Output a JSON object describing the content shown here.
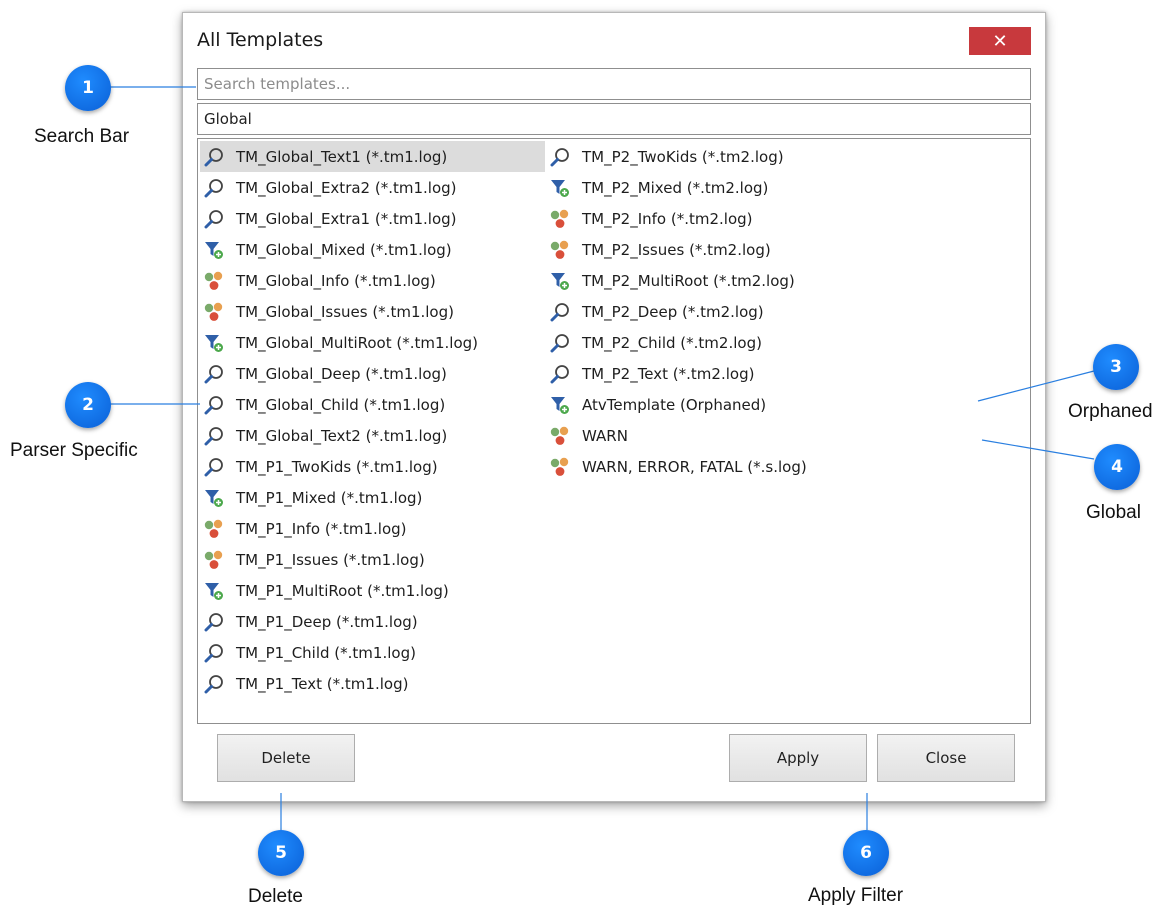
{
  "dialog": {
    "title": "All Templates",
    "close_glyph": "✕",
    "search_placeholder": "Search templates...",
    "category": "Global",
    "delete_label": "Delete",
    "apply_label": "Apply",
    "close_label": "Close"
  },
  "templates": {
    "column1": [
      {
        "label": "TM_Global_Text1 (*.tm1.log)",
        "icon": "search-icon",
        "selected": true
      },
      {
        "label": "TM_Global_Extra2 (*.tm1.log)",
        "icon": "search-icon"
      },
      {
        "label": "TM_Global_Extra1 (*.tm1.log)",
        "icon": "search-icon"
      },
      {
        "label": "TM_Global_Mixed (*.tm1.log)",
        "icon": "filter-icon"
      },
      {
        "label": "TM_Global_Info (*.tm1.log)",
        "icon": "dots-icon"
      },
      {
        "label": "TM_Global_Issues (*.tm1.log)",
        "icon": "dots-icon"
      },
      {
        "label": "TM_Global_MultiRoot (*.tm1.log)",
        "icon": "filter-icon"
      },
      {
        "label": "TM_Global_Deep (*.tm1.log)",
        "icon": "search-icon"
      },
      {
        "label": "TM_Global_Child (*.tm1.log)",
        "icon": "search-icon"
      },
      {
        "label": "TM_Global_Text2 (*.tm1.log)",
        "icon": "search-icon"
      },
      {
        "label": "TM_P1_TwoKids (*.tm1.log)",
        "icon": "search-icon"
      },
      {
        "label": "TM_P1_Mixed (*.tm1.log)",
        "icon": "filter-icon"
      },
      {
        "label": "TM_P1_Info (*.tm1.log)",
        "icon": "dots-icon"
      },
      {
        "label": "TM_P1_Issues (*.tm1.log)",
        "icon": "dots-icon"
      },
      {
        "label": "TM_P1_MultiRoot (*.tm1.log)",
        "icon": "filter-icon"
      },
      {
        "label": "TM_P1_Deep (*.tm1.log)",
        "icon": "search-icon"
      },
      {
        "label": "TM_P1_Child (*.tm1.log)",
        "icon": "search-icon"
      },
      {
        "label": "TM_P1_Text (*.tm1.log)",
        "icon": "search-icon"
      }
    ],
    "column2": [
      {
        "label": "TM_P2_TwoKids (*.tm2.log)",
        "icon": "search-icon"
      },
      {
        "label": "TM_P2_Mixed (*.tm2.log)",
        "icon": "filter-icon"
      },
      {
        "label": "TM_P2_Info (*.tm2.log)",
        "icon": "dots-icon"
      },
      {
        "label": "TM_P2_Issues (*.tm2.log)",
        "icon": "dots-icon"
      },
      {
        "label": "TM_P2_MultiRoot (*.tm2.log)",
        "icon": "filter-icon"
      },
      {
        "label": "TM_P2_Deep (*.tm2.log)",
        "icon": "search-icon"
      },
      {
        "label": "TM_P2_Child (*.tm2.log)",
        "icon": "search-icon"
      },
      {
        "label": "TM_P2_Text (*.tm2.log)",
        "icon": "search-icon"
      },
      {
        "label": "AtvTemplate (Orphaned)",
        "icon": "filter-icon"
      },
      {
        "label": "WARN",
        "icon": "dots-icon"
      },
      {
        "label": "WARN, ERROR, FATAL (*.s.log)",
        "icon": "dots-icon"
      }
    ]
  },
  "callouts": [
    {
      "number": "1",
      "label": "Search Bar"
    },
    {
      "number": "2",
      "label": "Parser Specific"
    },
    {
      "number": "3",
      "label": "Orphaned"
    },
    {
      "number": "4",
      "label": "Global"
    },
    {
      "number": "5",
      "label": "Delete"
    },
    {
      "number": "6",
      "label": "Apply Filter"
    }
  ],
  "colors": {
    "callout_blue": "#1177ee",
    "close_red": "#c8393d",
    "icon_blue": "#2f5fa8",
    "icon_green": "#4ca84c",
    "dot_green": "#7aaa6a",
    "dot_orange": "#e8a050",
    "dot_red": "#d94f3a"
  }
}
